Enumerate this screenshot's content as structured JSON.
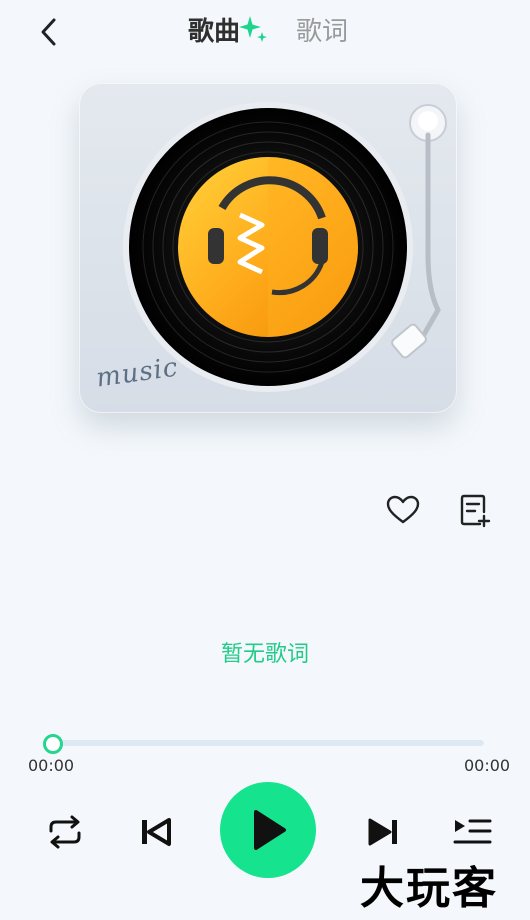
{
  "header": {
    "tabs": [
      {
        "label": "歌曲",
        "active": true
      },
      {
        "label": "歌词",
        "active": false
      }
    ]
  },
  "turntable": {
    "label": "music"
  },
  "lyrics": {
    "empty_text": "暂无歌词"
  },
  "progress": {
    "current_time": "00:00",
    "total_time": "00:00",
    "fraction": 0
  },
  "icons": {
    "back": "chevron-left-icon",
    "like": "heart-icon",
    "add_to_playlist": "playlist-add-icon",
    "repeat": "repeat-icon",
    "previous": "skip-previous-icon",
    "play": "play-icon",
    "next": "skip-next-icon",
    "queue": "queue-icon"
  },
  "colors": {
    "accent": "#16e38e",
    "lyrics_text": "#22cc88",
    "background": "#f4f8fc"
  },
  "watermark": "大玩客"
}
